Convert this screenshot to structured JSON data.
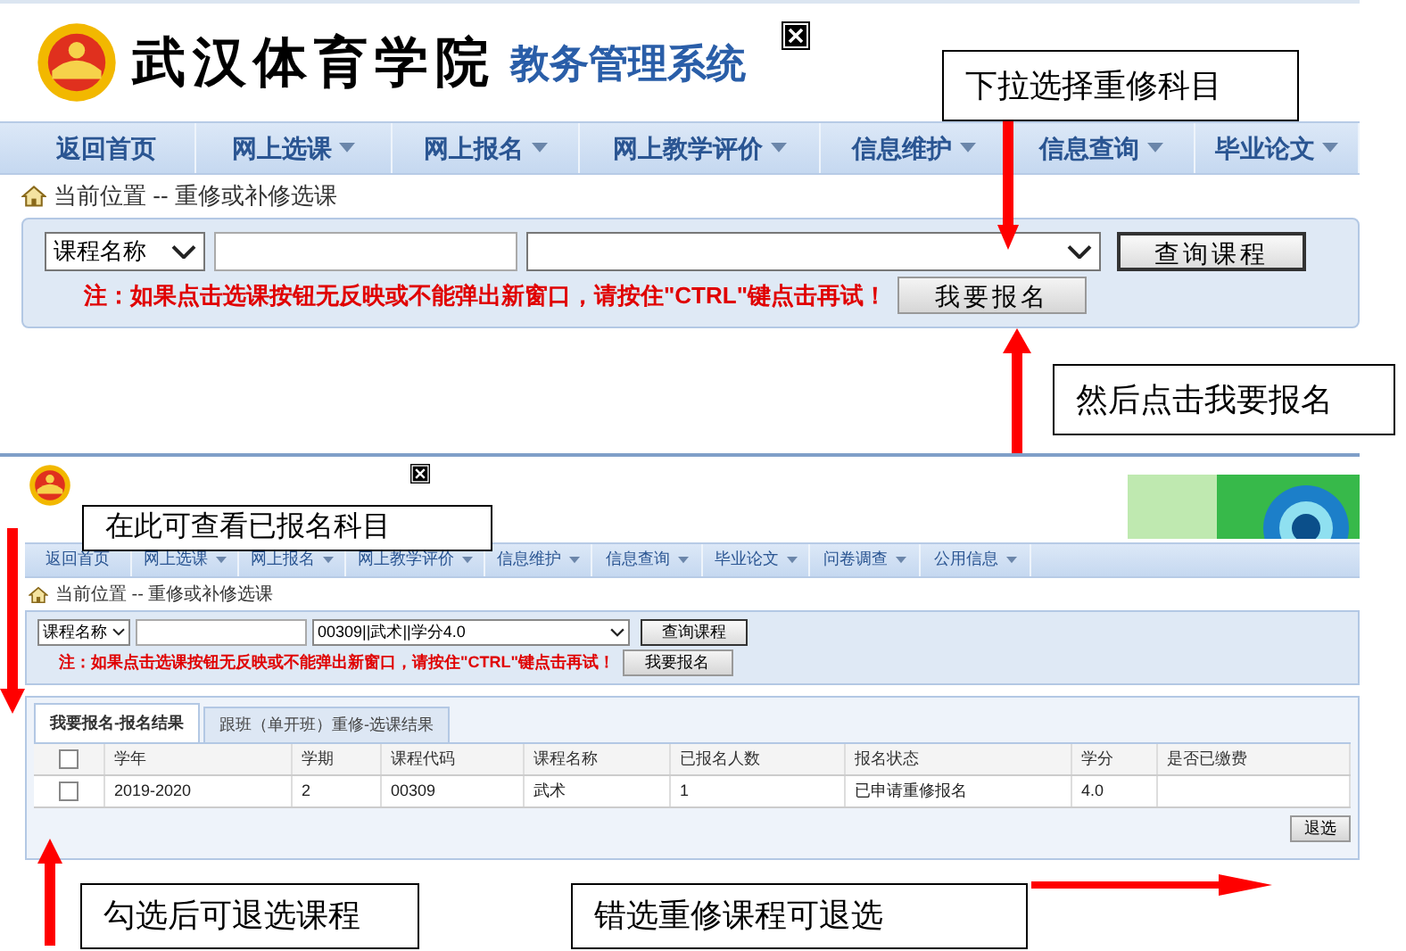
{
  "top_screenshot": {
    "header": {
      "school_name": "武汉体育学院",
      "system_name": "教务管理系统"
    },
    "nav": [
      {
        "label": "返回首页",
        "dropdown": false
      },
      {
        "label": "网上选课",
        "dropdown": true
      },
      {
        "label": "网上报名",
        "dropdown": true
      },
      {
        "label": "网上教学评价",
        "dropdown": true
      },
      {
        "label": "信息维护",
        "dropdown": true
      },
      {
        "label": "信息查询",
        "dropdown": true
      },
      {
        "label": "毕业论文",
        "dropdown": true
      }
    ],
    "breadcrumb": "当前位置 -- 重修或补修选课",
    "search": {
      "field_select": "课程名称",
      "query_button": "查询课程",
      "note": "注：如果点击选课按钮无反映或不能弹出新窗口，请按住\"CTRL\"键点击再试！",
      "apply_button": "我要报名"
    }
  },
  "bottom_screenshot": {
    "nav": [
      {
        "label": "返回首页",
        "dropdown": false
      },
      {
        "label": "网上选课",
        "dropdown": true
      },
      {
        "label": "网上报名",
        "dropdown": true
      },
      {
        "label": "网上教学评价",
        "dropdown": true
      },
      {
        "label": "信息维护",
        "dropdown": true
      },
      {
        "label": "信息查询",
        "dropdown": true
      },
      {
        "label": "毕业论文",
        "dropdown": true
      },
      {
        "label": "问卷调查",
        "dropdown": true
      },
      {
        "label": "公用信息",
        "dropdown": true
      }
    ],
    "breadcrumb": "当前位置 -- 重修或补修选课",
    "search": {
      "field_select": "课程名称",
      "course_select": "00309||武术||学分4.0",
      "query_button": "查询课程",
      "note": "注：如果点击选课按钮无反映或不能弹出新窗口，请按住\"CTRL\"键点击再试！",
      "apply_button": "我要报名"
    },
    "tabs": [
      {
        "label": "我要报名-报名结果",
        "selected": true
      },
      {
        "label": "跟班（单开班）重修-选课结果",
        "selected": false
      }
    ],
    "table": {
      "select_all_checked": false,
      "columns": [
        "学年",
        "学期",
        "课程代码",
        "课程名称",
        "已报名人数",
        "报名状态",
        "学分",
        "是否已缴费"
      ],
      "rows": [
        {
          "checked": false,
          "cells": [
            "2019-2020",
            "2",
            "00309",
            "武术",
            "1",
            "已申请重修报名",
            "4.0"
          ]
        }
      ]
    },
    "withdraw_button": "退选"
  },
  "callouts": [
    {
      "text": "下拉选择重修科目"
    },
    {
      "text": "然后点击我要报名"
    },
    {
      "text": "在此可查看已报名科目"
    },
    {
      "text": "勾选后可退选课程"
    },
    {
      "text": "错选重修课程可退选"
    }
  ]
}
